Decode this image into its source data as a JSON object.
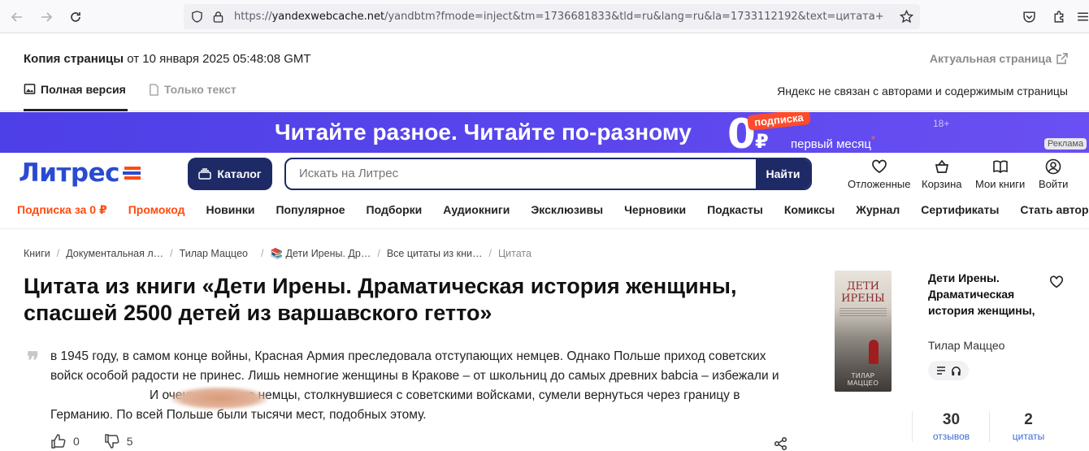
{
  "browser": {
    "url_prefix": "https://",
    "url_domain": "yandexwebcache.net",
    "url_rest": "/yandbtm?fmode=inject&tm=1736681833&tld=ru&lang=ru&la=1733112192&text=цитата+из+книги"
  },
  "cache": {
    "title_bold": "Копия страницы",
    "title_rest": " от 10 января 2025 05:48:08 GMT",
    "actual_link": "Актуальная страница",
    "tab_full": "Полная версия",
    "tab_text": "Только текст",
    "disclaimer": "Яндекс не связан с авторами и содержимым страницы"
  },
  "banner": {
    "text": "Читайте разное. Читайте по-разному",
    "zero": "0",
    "rub": "₽",
    "badge": "подписка",
    "month": "первый месяц",
    "star": "*",
    "age": "18+",
    "ad": "Реклама"
  },
  "header": {
    "logo": "Литрес",
    "catalog": "Каталог",
    "search_placeholder": "Искать на Литрес",
    "search_button": "Найти",
    "actions": {
      "favorites": "Отложенные",
      "cart": "Корзина",
      "my_books": "Мои книги",
      "login": "Войти"
    }
  },
  "menu": {
    "items": [
      "Подписка за 0 ₽",
      "Промокод",
      "Новинки",
      "Популярное",
      "Подборки",
      "Аудиокниги",
      "Эксклюзивы",
      "Черновики",
      "Подкасты",
      "Комиксы",
      "Журнал",
      "Сертификаты",
      "Стать автором"
    ]
  },
  "breadcrumb": {
    "items": [
      "Книги",
      "Документальная л…",
      "Тилар Маццео",
      "📚 Дети Ирены. Др…",
      "Все цитаты из кни…",
      "Цитата"
    ]
  },
  "page": {
    "title": "Цитата из книги «Дети Ирены. Драматическая история женщины, спасшей 2500 детей из варшавского гетто»",
    "quote_mark": "❞",
    "quote_part1": "в 1945 году, в самом конце войны, Красная Армия преследовала отступающих немцев. Однако Польше приход советских войск особой радости не принес. Лишь немногие женщины в Кракове – от школьниц до самых древних babcia – избежали и",
    "quote_part2": "И очень немногие немцы, столкнувшиеся с советскими войсками, сумели вернуться через границу в Германию. По всей Польше были тысячи мест, подобных этому.",
    "likes": "0",
    "dislikes": "5"
  },
  "aside": {
    "cover_title": "ДЕТИ ИРЕНЫ",
    "cover_author": "ТИЛАР МАЦЦЕО",
    "title": "Дети Ирены. Драматическая история женщины,",
    "author": "Тилар Маццео",
    "reviews_count": "30",
    "reviews_label": "отзывов",
    "quotes_count": "2",
    "quotes_label": "цитаты"
  }
}
